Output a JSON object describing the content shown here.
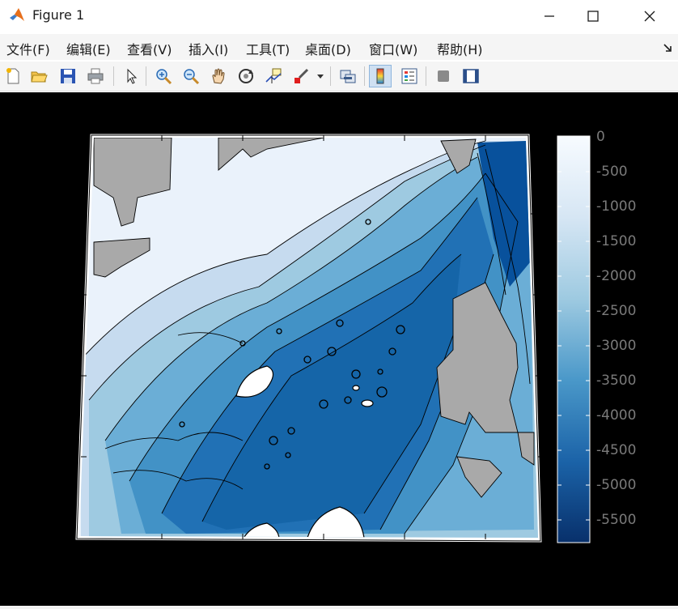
{
  "window": {
    "title": "Figure 1",
    "minimize_glyph": "—",
    "maximize_glyph": "☐",
    "close_glyph": "✕"
  },
  "menu": {
    "items": [
      "文件(F)",
      "编辑(E)",
      "查看(V)",
      "插入(I)",
      "工具(T)",
      "桌面(D)",
      "窗口(W)",
      "帮助(H)"
    ]
  },
  "toolbar": {
    "tools": [
      "new-figure-icon",
      "open-file-icon",
      "save-icon",
      "print-icon",
      "pointer-icon",
      "zoom-in-icon",
      "zoom-out-icon",
      "pan-hand-icon",
      "rotate-3d-icon",
      "data-cursor-icon",
      "brush-icon",
      "brush-dropdown-icon",
      "link-plot-icon",
      "colorbar-icon",
      "legend-icon",
      "hide-plot-tools-icon",
      "show-plot-tools-icon"
    ],
    "active_tool": "colorbar-icon"
  },
  "colors": {
    "figure_background": "#000000",
    "ocean_shallow": "#f7fbff",
    "ocean_deep": "#08306b",
    "land": "#a9a9a9",
    "colorbar_label": "#7a7a7a"
  },
  "colorbar": {
    "tick_labels": [
      "0",
      "-500",
      "-1000",
      "-1500",
      "-2000",
      "-2500",
      "-3000",
      "-3500",
      "-4000",
      "-4500",
      "-5000",
      "-5500"
    ],
    "min": -5900,
    "max": 0,
    "colormap": "Blues (reversed)"
  },
  "map": {
    "type": "bathymetry contour map",
    "contour_color": "#000000",
    "projection": "conic"
  }
}
